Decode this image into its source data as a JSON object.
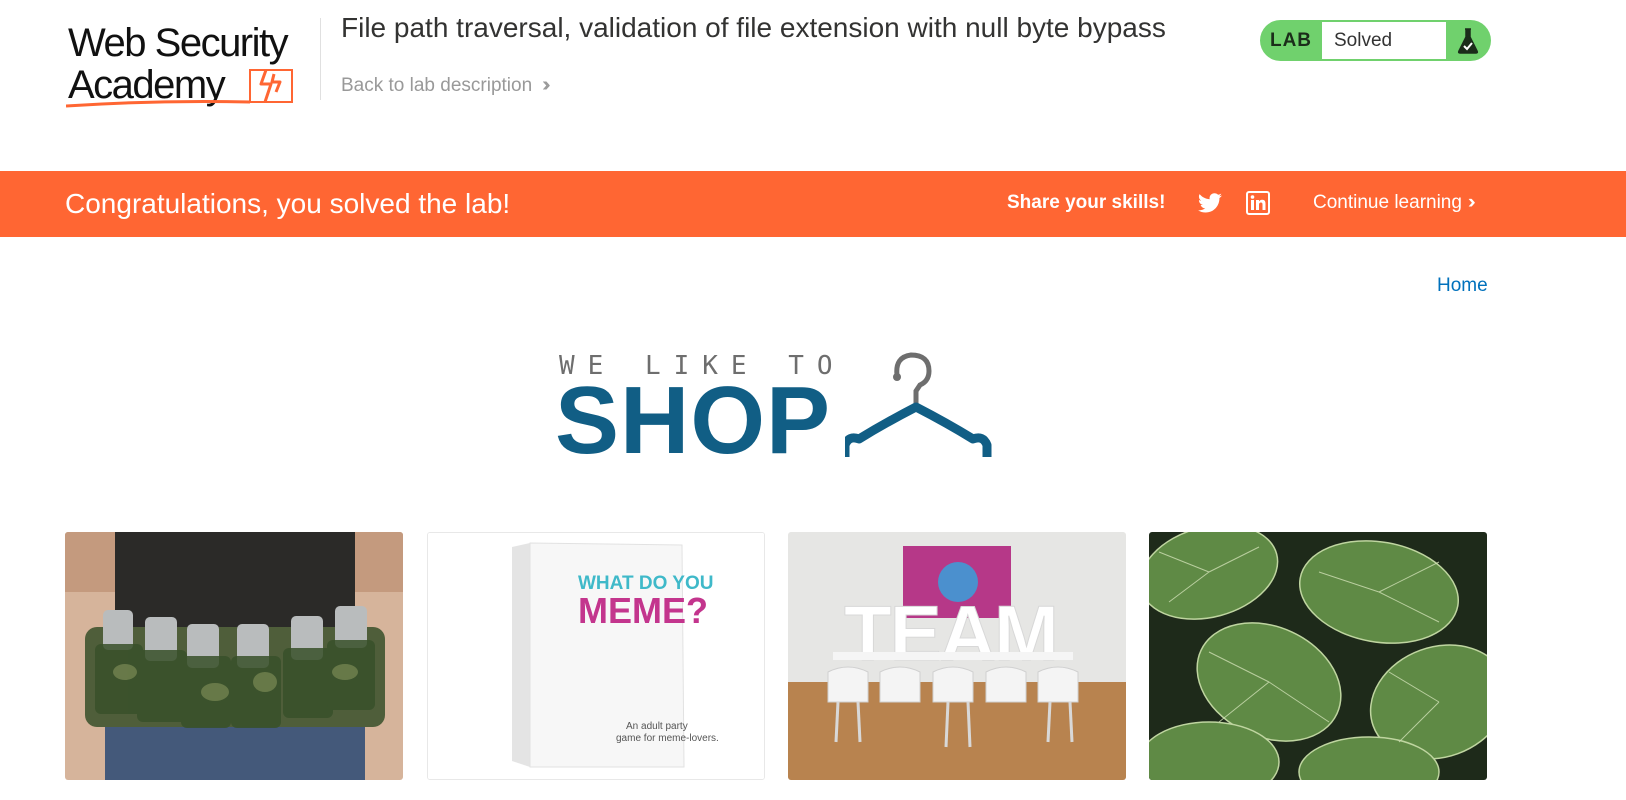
{
  "header": {
    "logo_line1": "Web Security",
    "logo_line2": "Academy",
    "lab_title": "File path traversal, validation of file extension with null byte bypass",
    "back_link": "Back to lab description",
    "lab_badge": "LAB",
    "lab_status": "Solved",
    "icons": [
      "lightning-icon",
      "chevron-right-icon",
      "flask-icon"
    ]
  },
  "banner": {
    "message": "Congratulations, you solved the lab!",
    "share": "Share your skills!",
    "continue": "Continue learning",
    "icons": [
      "twitter-icon",
      "linkedin-icon",
      "chevron-right-icon"
    ]
  },
  "nav": {
    "home": "Home"
  },
  "shop_logo": {
    "tagline": "WE LIKE TO",
    "word": "SHOP",
    "icon": "hanger-icon"
  },
  "products": [
    {
      "image": "beer-belt-photo"
    },
    {
      "image": "card-game-box-photo",
      "box_text_1": "WHAT DO YOU",
      "box_text_2": "MEME?",
      "box_caption_1": "An adult party",
      "box_caption_2": "game for meme-lovers."
    },
    {
      "image": "team-room-photo",
      "word": "TEAM"
    },
    {
      "image": "green-leaves-photo"
    }
  ],
  "colors": {
    "brand_orange": "#ff6633",
    "status_green": "#70d16d",
    "shop_blue": "#115e85",
    "link_blue": "#0071bc"
  }
}
